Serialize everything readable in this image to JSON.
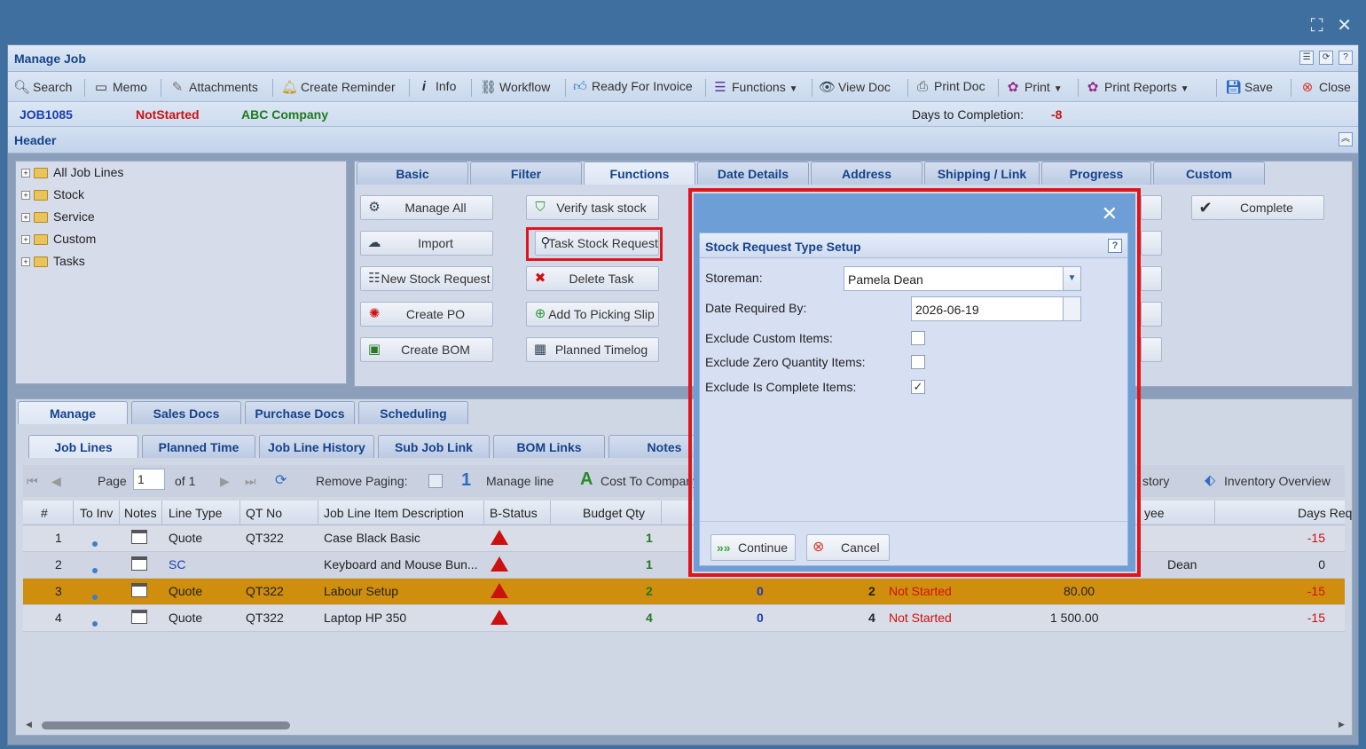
{
  "window": {
    "title": "Manage Job"
  },
  "toolbar": {
    "search": "Search",
    "memo": "Memo",
    "attachments": "Attachments",
    "create_reminder": "Create Reminder",
    "info": "Info",
    "workflow": "Workflow",
    "ready_for_invoice": "Ready For Invoice",
    "functions": "Functions",
    "view_doc": "View Doc",
    "print_doc": "Print Doc",
    "print": "Print",
    "print_reports": "Print Reports",
    "save": "Save",
    "close": "Close"
  },
  "job": {
    "number": "JOB1085",
    "status": "NotStarted",
    "company": "ABC Company",
    "days_label": "Days to Completion:",
    "days_value": "-8"
  },
  "header": {
    "title": "Header"
  },
  "tree": [
    "All Job Lines",
    "Stock",
    "Service",
    "Custom",
    "Tasks"
  ],
  "top_tabs": [
    "Basic",
    "Filter",
    "Functions",
    "Date Details",
    "Address",
    "Shipping / Link",
    "Progress",
    "Custom"
  ],
  "functions": {
    "manage_all": "Manage All",
    "import": "Import",
    "new_stock_request": "New Stock Request",
    "create_po": "Create PO",
    "create_bom": "Create BOM",
    "verify_task_stock": "Verify task stock",
    "task_stock_request": "Task Stock Request",
    "delete_task": "Delete Task",
    "add_to_picking_slip": "Add To Picking Slip",
    "planned_timelog": "Planned Timelog",
    "complete": "Complete"
  },
  "bottom_tabs": [
    "Manage",
    "Sales Docs",
    "Purchase Docs",
    "Scheduling"
  ],
  "sub_tabs": [
    "Job Lines",
    "Planned Time",
    "Job Line History",
    "Sub Job Link",
    "BOM Links",
    "Notes"
  ],
  "pager": {
    "page_label": "Page",
    "page_value": "1",
    "of_label": "of 1",
    "remove_paging": "Remove Paging:",
    "manage_line_num": "1",
    "manage_line": "Manage line",
    "cost_to_company": "Cost To Company",
    "history_partial": "story",
    "inventory_overview": "Inventory Overview"
  },
  "grid": {
    "headers": [
      "#",
      "To Inv",
      "Notes",
      "Line Type",
      "QT No",
      "Job Line Item Description",
      "B-Status",
      "Budget Qty",
      "yee",
      "Days Req"
    ],
    "rows": [
      {
        "n": "1",
        "type": "Quote",
        "qt": "QT322",
        "desc": "Case Black Basic",
        "budget": "1",
        "c9": "",
        "c10": "",
        "c11": "",
        "c12": "",
        "assignee": "",
        "days": "-15"
      },
      {
        "n": "2",
        "type": "SC",
        "qt": "",
        "desc": "Keyboard and Mouse Bun...",
        "budget": "1",
        "c9": "",
        "c10": "",
        "c11": "",
        "c12": "",
        "assignee": "Dean",
        "days": "0"
      },
      {
        "n": "3",
        "type": "Quote",
        "qt": "QT322",
        "desc": "Labour Setup",
        "budget": "2",
        "c9": "0",
        "c10": "2",
        "c11": "Not Started",
        "c12": "80.00",
        "assignee": "",
        "days": "-15"
      },
      {
        "n": "4",
        "type": "Quote",
        "qt": "QT322",
        "desc": "Laptop HP 350",
        "budget": "4",
        "c9": "0",
        "c10": "4",
        "c11": "Not Started",
        "c12": "1 500.00",
        "assignee": "",
        "days": "-15"
      }
    ]
  },
  "dialog": {
    "title": "Stock Request Type Setup",
    "storeman_label": "Storeman:",
    "storeman_value": "Pamela Dean",
    "date_label": "Date Required By:",
    "date_value": "2026-06-19",
    "exclude_custom_label": "Exclude Custom Items:",
    "exclude_custom_checked": false,
    "exclude_zero_label": "Exclude Zero Quantity Items:",
    "exclude_zero_checked": false,
    "exclude_complete_label": "Exclude Is Complete Items:",
    "exclude_complete_checked": true,
    "continue": "Continue",
    "cancel": "Cancel"
  },
  "colors": {
    "highlight": "#e1141b",
    "accent": "#15428b",
    "selected_row": "#cf8e0e"
  }
}
